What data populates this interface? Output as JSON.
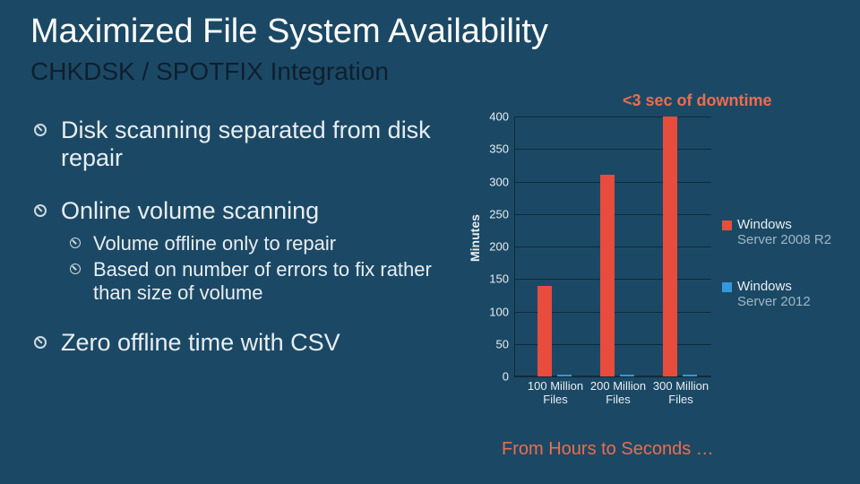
{
  "title": "Maximized File System Availability",
  "subtitle": "CHKDSK / SPOTFIX Integration",
  "bullets": [
    {
      "text": "Disk scanning separated from disk repair"
    },
    {
      "text": "Online volume scanning",
      "sub": [
        "Volume offline only to repair",
        "Based on number of errors to fix rather than size of volume"
      ]
    },
    {
      "text": "Zero offline time with CSV"
    }
  ],
  "downtime_label": "<3 sec of downtime",
  "caption": "From Hours to Seconds …",
  "chart_data": {
    "type": "bar",
    "ylabel": "Minutes",
    "ylim": [
      0,
      400
    ],
    "yticks": [
      0,
      50,
      100,
      150,
      200,
      250,
      300,
      350,
      400
    ],
    "categories": [
      "100 Million Files",
      "200 Million Files",
      "300 Million Files"
    ],
    "series": [
      {
        "name": "Windows Server 2008 R2",
        "color": "#e84c3d",
        "values": [
          140,
          310,
          400
        ]
      },
      {
        "name": "Windows Server 2012",
        "color": "#3498db",
        "values": [
          3,
          3,
          3
        ]
      }
    ],
    "legend_lines": [
      [
        "Windows",
        "Server 2008 R2"
      ],
      [
        "Windows",
        "Server 2012"
      ]
    ]
  }
}
